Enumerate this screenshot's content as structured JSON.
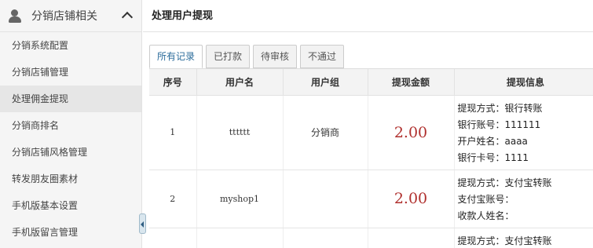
{
  "sidebar": {
    "header": {
      "title": "分销店铺相关"
    },
    "items": [
      {
        "label": "分销系统配置"
      },
      {
        "label": "分销店铺管理"
      },
      {
        "label": "处理佣金提现"
      },
      {
        "label": "分销商排名"
      },
      {
        "label": "分销店铺风格管理"
      },
      {
        "label": "转发朋友圈素材"
      },
      {
        "label": "手机版基本设置"
      },
      {
        "label": "手机版留言管理"
      }
    ]
  },
  "main": {
    "title": "处理用户提现",
    "tabs": [
      {
        "label": "所有记录"
      },
      {
        "label": "已打款"
      },
      {
        "label": "待审核"
      },
      {
        "label": "不通过"
      }
    ],
    "table": {
      "headers": [
        "序号",
        "用户名",
        "用户组",
        "提现金额",
        "提现信息"
      ],
      "rows": [
        {
          "index": "1",
          "username": "tttttt",
          "group": "分销商",
          "amount": "2.00",
          "info": [
            "提现方式：银行转账",
            "银行账号：111111",
            "开户姓名：aaaa",
            "银行卡号：1111"
          ]
        },
        {
          "index": "2",
          "username": "myshop1",
          "group": "",
          "amount": "2.00",
          "info": [
            "提现方式：支付宝转账",
            "支付宝账号：",
            "收款人姓名："
          ]
        },
        {
          "index": "",
          "username": "",
          "group": "",
          "amount": "",
          "info": [
            "提现方式：支付宝转账"
          ]
        }
      ]
    }
  },
  "colors": {
    "amount": "#b0302e",
    "active_tab_text": "#2b6c9b",
    "sidebar_bg": "#f5f5f5"
  },
  "icons": {
    "header_icon": "user-icon",
    "header_chevron": "chevron-up-icon",
    "collapse": "collapse-left-icon"
  }
}
